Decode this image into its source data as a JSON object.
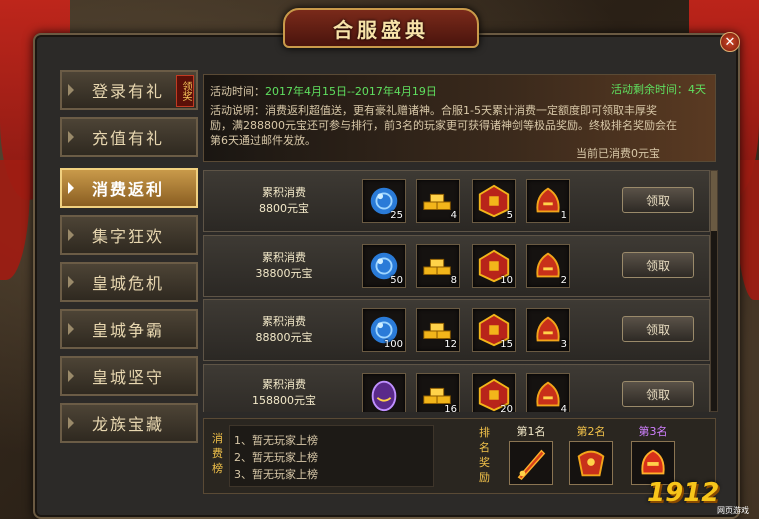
{
  "title": "合服盛典",
  "colors": {
    "accent_gold": "#f2c24a",
    "active_tab": "#c99a4a",
    "green_text": "#5fe05f",
    "curtain_red": "#c8241a"
  },
  "close_icon": "close-icon",
  "sidebar": {
    "items": [
      {
        "label": "登录有礼",
        "tag": "领奖",
        "active": false
      },
      {
        "label": "充值有礼",
        "active": false
      },
      {
        "label": "消费返利",
        "active": true
      },
      {
        "label": "集字狂欢",
        "active": false
      },
      {
        "label": "皇城危机",
        "active": false
      },
      {
        "label": "皇城争霸",
        "active": false
      },
      {
        "label": "皇城坚守",
        "active": false
      },
      {
        "label": "龙族宝藏",
        "active": false
      }
    ]
  },
  "info": {
    "time_label": "活动时间：",
    "time_value": "2017年4月15日--2017年4月19日",
    "remaining_label": "活动剩余时间：",
    "remaining_value": "4天",
    "desc_line1": "活动说明：消费返利超值送，更有豪礼赠诸神。合服1-5天累计消费一定额度即可领取丰厚奖",
    "desc_line2": "励，满288800元宝还可参与排行，前3名的玩家更可获得诸神剑等极品奖励。终极排名奖励会在",
    "desc_line3": "第6天通过邮件发放。",
    "current_label": "当前已消费",
    "current_value": "0元宝"
  },
  "rewards": [
    {
      "title": "累积消费",
      "amount": "8800元宝",
      "items": [
        {
          "icon": "blue-orb-icon",
          "count": "25"
        },
        {
          "icon": "gold-bars-icon",
          "count": "4"
        },
        {
          "icon": "red-chest-icon",
          "count": "5"
        },
        {
          "icon": "fire-helmet-icon",
          "count": "1"
        }
      ],
      "button": "领取"
    },
    {
      "title": "累积消费",
      "amount": "38800元宝",
      "items": [
        {
          "icon": "blue-orb-icon",
          "count": "50"
        },
        {
          "icon": "gold-bars-icon",
          "count": "8"
        },
        {
          "icon": "red-chest-icon",
          "count": "10"
        },
        {
          "icon": "fire-helmet-icon",
          "count": "2"
        }
      ],
      "button": "领取"
    },
    {
      "title": "累积消费",
      "amount": "88800元宝",
      "items": [
        {
          "icon": "blue-orb-icon",
          "count": "100"
        },
        {
          "icon": "gold-bars-icon",
          "count": "12"
        },
        {
          "icon": "red-chest-icon",
          "count": "15"
        },
        {
          "icon": "fire-helmet-icon",
          "count": "3"
        }
      ],
      "button": "领取"
    },
    {
      "title": "累积消费",
      "amount": "158800元宝",
      "items": [
        {
          "icon": "purple-egg-icon",
          "count": ""
        },
        {
          "icon": "gold-bars-icon",
          "count": "16"
        },
        {
          "icon": "red-chest-icon",
          "count": "20"
        },
        {
          "icon": "fire-helmet-icon",
          "count": "4"
        }
      ],
      "button": "领取"
    }
  ],
  "ranking": {
    "vertical_label": [
      "消",
      "费",
      "榜"
    ],
    "lines": [
      "1、暂无玩家上榜",
      "2、暂无玩家上榜",
      "3、暂无玩家上榜"
    ],
    "prize_label": [
      "排",
      "名",
      "奖",
      "励"
    ],
    "prizes": [
      {
        "rank": "第1名",
        "icon": "fire-sword-icon"
      },
      {
        "rank": "第2名",
        "icon": "red-armor-icon"
      },
      {
        "rank": "第3名",
        "icon": "red-helmet-icon"
      }
    ]
  },
  "logo": {
    "number": "1912",
    "sub": "网页游戏"
  }
}
